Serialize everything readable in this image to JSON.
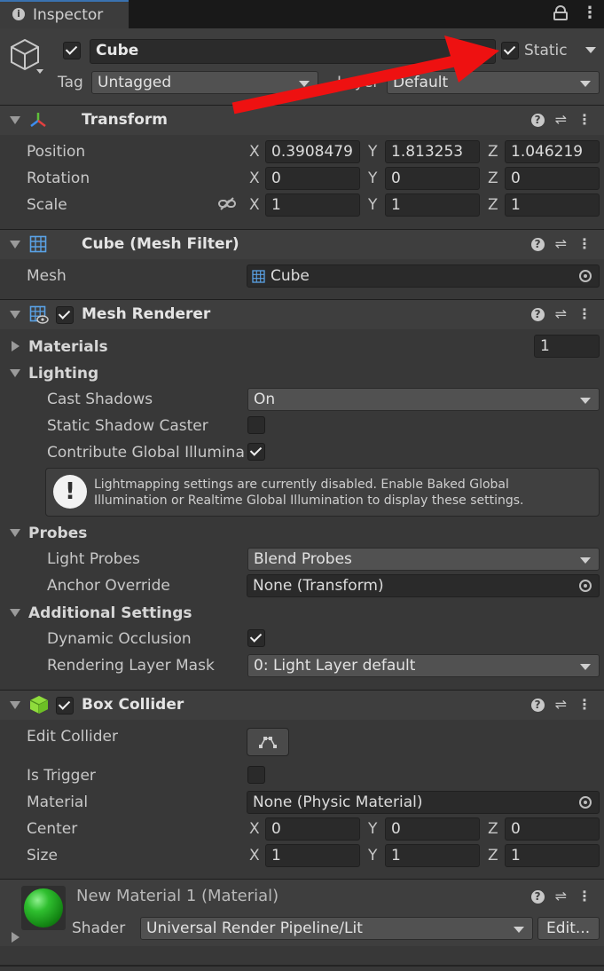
{
  "tab": {
    "title": "Inspector"
  },
  "object": {
    "name": "Cube",
    "static_label": "Static",
    "tag_label": "Tag",
    "tag_value": "Untagged",
    "layer_label": "Layer",
    "layer_value": "Default"
  },
  "transform": {
    "title": "Transform",
    "position": {
      "label": "Position",
      "x": "0.3908479",
      "y": "1.813253",
      "z": "1.046219"
    },
    "rotation": {
      "label": "Rotation",
      "x": "0",
      "y": "0",
      "z": "0"
    },
    "scale": {
      "label": "Scale",
      "x": "1",
      "y": "1",
      "z": "1"
    },
    "axes": {
      "x": "X",
      "y": "Y",
      "z": "Z"
    }
  },
  "mesh_filter": {
    "title": "Cube (Mesh Filter)",
    "mesh_label": "Mesh",
    "mesh_value": "Cube"
  },
  "mesh_renderer": {
    "title": "Mesh Renderer",
    "materials_label": "Materials",
    "materials_count": "1",
    "lighting_label": "Lighting",
    "cast_shadows_label": "Cast Shadows",
    "cast_shadows_value": "On",
    "static_shadow_label": "Static Shadow Caster",
    "contribute_gi_label": "Contribute Global Illumina",
    "info_text_1": "Lightmapping settings are currently disabled. Enable Baked Global",
    "info_text_2": "Illumination or Realtime Global Illumination to display these settings.",
    "probes_label": "Probes",
    "light_probes_label": "Light Probes",
    "light_probes_value": "Blend Probes",
    "anchor_label": "Anchor Override",
    "anchor_value": "None (Transform)",
    "additional_label": "Additional Settings",
    "dynamic_occlusion_label": "Dynamic Occlusion",
    "rendering_layer_label": "Rendering Layer Mask",
    "rendering_layer_value": "0: Light Layer default"
  },
  "box_collider": {
    "title": "Box Collider",
    "edit_label": "Edit Collider",
    "trigger_label": "Is Trigger",
    "material_label": "Material",
    "material_value": "None (Physic Material)",
    "center": {
      "label": "Center",
      "x": "0",
      "y": "0",
      "z": "0"
    },
    "size": {
      "label": "Size",
      "x": "1",
      "y": "1",
      "z": "1"
    }
  },
  "material": {
    "title": "New Material 1 (Material)",
    "shader_label": "Shader",
    "shader_value": "Universal Render Pipeline/Lit",
    "edit_button": "Edit..."
  },
  "colors": {
    "background": "#383838",
    "header": "#3e3e3e",
    "field": "#2a2a2a",
    "arrow": "#ee1111",
    "sphere": "#1fa31f"
  }
}
